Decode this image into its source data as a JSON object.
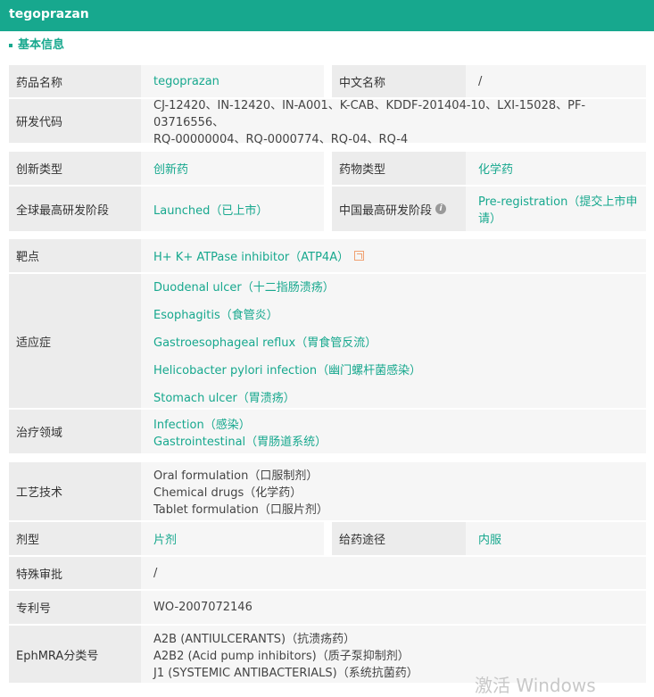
{
  "header": {
    "title": "tegoprazan"
  },
  "section": {
    "title": "基本信息"
  },
  "rows": {
    "drug_name": {
      "label": "药品名称",
      "value": "tegoprazan"
    },
    "chinese_name": {
      "label": "中文名称",
      "value": "/"
    },
    "code": {
      "label": "研发代码",
      "line1": "CJ-12420、IN-12420、IN-A001、K-CAB、KDDF-201404-10、LXI-15028、PF-03716556、",
      "line2": "RQ-00000004、RQ-0000774、RQ-04、RQ-4"
    },
    "innovation": {
      "label": "创新类型",
      "value": "创新药"
    },
    "drug_type": {
      "label": "药物类型",
      "value": "化学药"
    },
    "global_stage": {
      "label": "全球最高研发阶段",
      "value": "Launched（已上市）"
    },
    "china_stage": {
      "label": "中国最高研发阶段",
      "line1": "Pre-registration（提交上市申",
      "line2": "请）"
    },
    "target": {
      "label": "靶点",
      "value": "H+ K+ ATPase inhibitor（ATP4A）"
    },
    "indications": {
      "label": "适应症",
      "items": [
        "Duodenal ulcer（十二指肠溃疡）",
        "Esophagitis（食管炎）",
        "Gastroesophageal reflux（胃食管反流）",
        "Helicobacter pylori infection（幽门螺杆菌感染）",
        "Stomach ulcer（胃溃疡）"
      ]
    },
    "therapy": {
      "label": "治疗领域",
      "items": [
        "Infection（感染）",
        "Gastrointestinal（胃肠道系统）"
      ]
    },
    "technology": {
      "label": "工艺技术",
      "items": [
        "Oral formulation（口服制剂）",
        "Chemical drugs（化学药）",
        "Tablet formulation（口服片剂）"
      ]
    },
    "dosage": {
      "label": "剂型",
      "value": "片剂"
    },
    "route": {
      "label": "给药途径",
      "value": "内服"
    },
    "special": {
      "label": "特殊审批",
      "value": "/"
    },
    "patent": {
      "label": "专利号",
      "value": "WO-2007072146"
    },
    "ephmra": {
      "label": "EphMRA分类号",
      "items": [
        "A2B (ANTIULCERANTS)（抗溃疡药）",
        "A2B2 (Acid pump inhibitors)（质子泵抑制剂）",
        "J1 (SYSTEMIC ANTIBACTERIALS)（系统抗菌药）"
      ]
    }
  },
  "watermark": "激活 Windows",
  "colors": {
    "accent": "#17a88e"
  }
}
